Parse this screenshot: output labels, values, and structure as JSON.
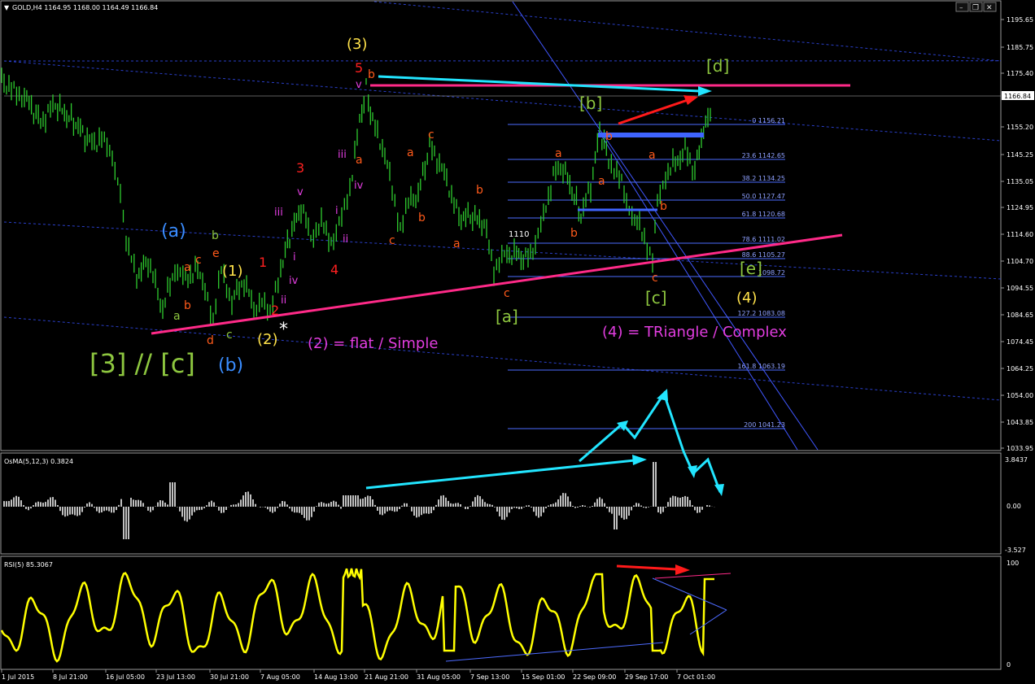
{
  "window": {
    "symbol_info": "GOLD,H4  1164.95 1168.00 1164.49 1166.84",
    "dropdown_glyph": "▼",
    "controls": {
      "minimize": "–",
      "restore": "❐",
      "close": "✕"
    }
  },
  "price_axis": {
    "labels": [
      "1195.65",
      "1185.75",
      "1175.40",
      "1166.84",
      "1155.20",
      "1145.25",
      "1135.05",
      "1124.95",
      "1114.60",
      "1104.70",
      "1094.55",
      "1084.65",
      "1074.45",
      "1064.25",
      "1054.00",
      "1043.85",
      "1033.95"
    ],
    "current": "1166.84"
  },
  "time_axis": {
    "labels": [
      "1 Jul 2015",
      "8 Jul 21:00",
      "16 Jul 05:00",
      "23 Jul 13:00",
      "30 Jul 21:00",
      "7 Aug 05:00",
      "14 Aug 13:00",
      "21 Aug 21:00",
      "31 Aug 05:00",
      "7 Sep 13:00",
      "15 Sep 01:00",
      "22 Sep 09:00",
      "29 Sep 17:00",
      "7 Oct 01:00"
    ]
  },
  "fibonacci": {
    "levels": [
      "0 1156.21",
      "23.6 1142.65",
      "38.2 1134.25",
      "50.0 1127.47",
      "61.8 1120.68",
      "78.6 1111.02",
      "88.6 1105.27",
      "1098.72",
      "127.2 1083.08",
      "161.8 1063.19",
      "200 1041.23"
    ]
  },
  "level_1110": "1110",
  "annotations": {
    "wave3_big": "[3] // [c]",
    "wave_a_blue": "(a)",
    "wave_b_blue": "(b)",
    "wave1": "(1)",
    "wave2": "(2)",
    "wave3": "(3)",
    "wave4": "(4)",
    "wave2_note": "(2) = flat / Simple",
    "wave4_note": "(4) = TRiangle / Complex",
    "sq_a": "[a]",
    "sq_b": "[b]",
    "sq_c": "[c]",
    "sq_d": "[d]",
    "sq_e": "[e]",
    "asterisk": "*"
  },
  "small_labels": {
    "red_1": "1",
    "red_2": "2",
    "red_3": "3",
    "red_4": "4",
    "red_5": "5",
    "m_i": "i",
    "m_ii": "ii",
    "m_iii": "iii",
    "m_iv": "iv",
    "m_v": "v",
    "m_i2": "i",
    "m_ii2": "ii",
    "m_iii2": "iii",
    "m_iv2": "iv",
    "m_v2": "v",
    "o_a": "a",
    "o_b": "b",
    "o_c": "c",
    "o_d": "d",
    "o_e": "e",
    "g_a": "a",
    "g_b": "b",
    "g_c": "c",
    "o_b2": "b",
    "o_a2": "a",
    "o_b3": "b",
    "o_c2": "c",
    "o_a3": "a",
    "o_c3": "c",
    "o_b4": "b",
    "o_a4": "a",
    "o_c4": "c",
    "o_a5": "a",
    "o_b5": "b",
    "o_b6": "b",
    "o_a6": "a",
    "o_a7": "a",
    "o_b7": "b",
    "o_c5": "c"
  },
  "osma": {
    "label": "OsMA(5,12,3) 0.3824",
    "axis": [
      "3.8437",
      "0.00",
      "-3.527"
    ]
  },
  "rsi": {
    "label": "RSI(5) 85.3067",
    "axis": [
      "100",
      "0"
    ]
  },
  "colors": {
    "price": "#2ecc2e",
    "rsi": "#ffff00",
    "osma": "#c0c0c0",
    "magenta_line": "#ff2a88",
    "cyan_arrow": "#22e5ff",
    "red_arrow": "#ff1a1a",
    "fib_line": "#4d6bff",
    "channel_line": "#2a3fc9"
  }
}
